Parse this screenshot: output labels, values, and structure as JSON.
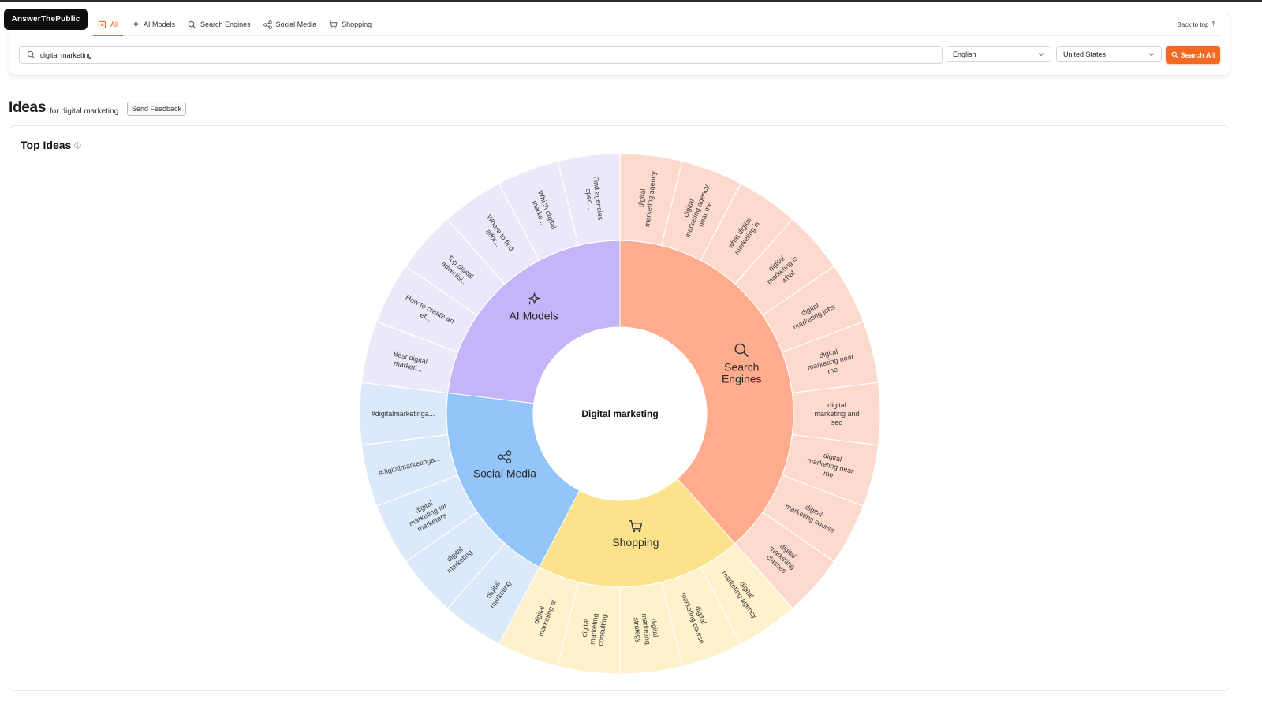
{
  "app": {
    "logo": "AnswerThePublic"
  },
  "nav": {
    "tabs": [
      {
        "label": "All",
        "icon": "all-icon",
        "active": true
      },
      {
        "label": "AI Models",
        "icon": "sparkle-icon",
        "active": false
      },
      {
        "label": "Search Engines",
        "icon": "search-icon",
        "active": false
      },
      {
        "label": "Social Media",
        "icon": "share-icon",
        "active": false
      },
      {
        "label": "Shopping",
        "icon": "cart-icon",
        "active": false
      }
    ],
    "back_to_top": "Back to top"
  },
  "search": {
    "query": "digital marketing",
    "language": "English",
    "country": "United States",
    "button": "Search All"
  },
  "ideas": {
    "title": "Ideas",
    "subtitle": "for digital marketing",
    "feedback_button": "Send Feedback"
  },
  "top_ideas": {
    "title": "Top Ideas"
  },
  "colors": {
    "accent": "#f26a22"
  },
  "chart_data": {
    "type": "sunburst",
    "center": "Digital marketing",
    "categories": [
      {
        "name": "Search Engines",
        "icon": "search-icon",
        "color": "#ffab8d",
        "light": "#fed9ce",
        "ideas": [
          "digital marketing agency",
          "digital marketing agency near me",
          "what digital marketing is",
          "digital marketing is what",
          "digital marketing jobs",
          "digital marketing near me",
          "digital marketing and seo",
          "digital marketing near me",
          "digital marketing course",
          "digital marketing classes"
        ]
      },
      {
        "name": "Shopping",
        "icon": "cart-icon",
        "color": "#fde28c",
        "light": "#fef1cb",
        "ideas": [
          "digital marketing agency",
          "digital marketing course",
          "digital marketing strategy",
          "digital marketing consulting",
          "digital marketing ai"
        ]
      },
      {
        "name": "Social Media",
        "icon": "share-icon",
        "color": "#93c5f9",
        "light": "#dce9fb",
        "ideas": [
          "digital marketing",
          "digital marketing`",
          "digital marketing for marketers",
          "#digitalmarketinga...",
          "#digitalmarketinga..."
        ]
      },
      {
        "name": "AI Models",
        "icon": "sparkle-icon",
        "color": "#c4b5f9",
        "light": "#ece8fa",
        "ideas": [
          "Best digital marketi...",
          "How to create an ef...",
          "Top digital advertisi...",
          "Where to find affor...",
          "Which digital marke...",
          "Find agencies spec..."
        ]
      }
    ]
  }
}
